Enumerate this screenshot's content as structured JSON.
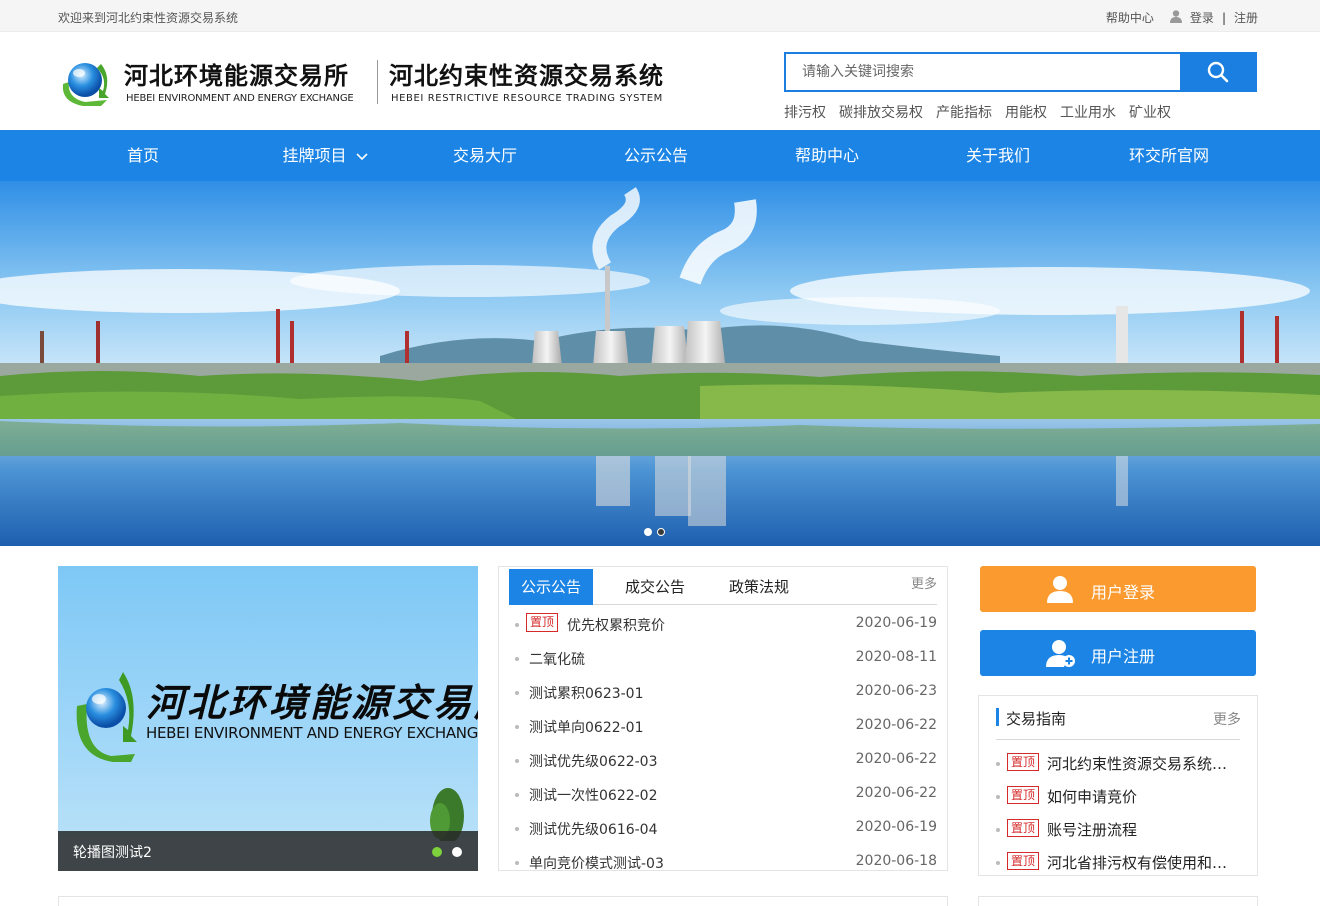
{
  "topbar": {
    "welcome": "欢迎来到河北约束性资源交易系统",
    "help": "帮助中心",
    "login": "登录",
    "separator": "|",
    "register": "注册"
  },
  "header": {
    "logo_cn_1": "河北环境能源交易所",
    "logo_en_1": "HEBEI ENVIRONMENT AND ENERGY EXCHANGE",
    "logo_cn_2": "河北约束性资源交易系统",
    "logo_en_2": "HEBEI RESTRICTIVE RESOURCE TRADING SYSTEM",
    "search_placeholder": "请输入关键词搜索",
    "hot_words": [
      "排污权",
      "碳排放交易权",
      "产能指标",
      "用能权",
      "工业用水",
      "矿业权"
    ]
  },
  "nav": {
    "items": [
      "首页",
      "挂牌项目",
      "交易大厅",
      "公示公告",
      "帮助中心",
      "关于我们",
      "环交所官网"
    ]
  },
  "carousel": {
    "logo_cn": "河北环境能源交易所",
    "logo_en": "HEBEI ENVIRONMENT AND ENERGY EXCHANGE",
    "caption": "轮播图测试2"
  },
  "notice": {
    "tabs": [
      "公示公告",
      "成交公告",
      "政策法规"
    ],
    "more": "更多",
    "pin_label": "置顶",
    "items": [
      {
        "title": "优先权累积竞价",
        "date": "2020-06-19",
        "pinned": true
      },
      {
        "title": "二氧化硫",
        "date": "2020-08-11",
        "pinned": false
      },
      {
        "title": "测试累积0623-01",
        "date": "2020-06-23",
        "pinned": false
      },
      {
        "title": "测试单向0622-01",
        "date": "2020-06-22",
        "pinned": false
      },
      {
        "title": "测试优先级0622-03",
        "date": "2020-06-22",
        "pinned": false
      },
      {
        "title": "测试一次性0622-02",
        "date": "2020-06-22",
        "pinned": false
      },
      {
        "title": "测试优先级0616-04",
        "date": "2020-06-19",
        "pinned": false
      },
      {
        "title": "单向竞价模式测试-03",
        "date": "2020-06-18",
        "pinned": false
      }
    ]
  },
  "user": {
    "login_label": "用户登录",
    "register_label": "用户注册"
  },
  "guide": {
    "title": "交易指南",
    "more": "更多",
    "pin_label": "置顶",
    "items": [
      "河北约束性资源交易系统…",
      "如何申请竞价",
      "账号注册流程",
      "河北省排污权有偿使用和…"
    ]
  },
  "colors": {
    "primary_blue": "#1b84e4",
    "orange": "#fb9a2f",
    "pin_red": "#d62a2a"
  }
}
